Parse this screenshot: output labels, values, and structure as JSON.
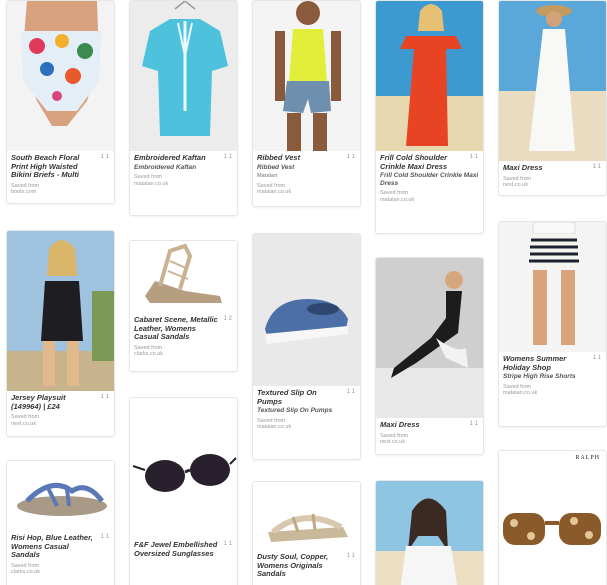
{
  "pins": [
    {
      "id": "p1",
      "title": "South Beach Floral Print High Waisted Bikini Briefs - Multi",
      "desc": "",
      "saved_label": "Saved from",
      "source": "boots.com",
      "count": "1 1",
      "icon": "floral-bikini-briefs-image"
    },
    {
      "id": "p2",
      "title": "Embroidered Kaftan",
      "desc": "Embroidered Kaftan",
      "saved_label": "Saved from",
      "source": "matalan.co.uk",
      "count": "1 1",
      "icon": "kaftan-image"
    },
    {
      "id": "p3",
      "title": "Ribbed Vest",
      "desc": "Ribbed Vest",
      "saved_label": "Saved from",
      "source": "matalan.co.uk",
      "count": "1 1",
      "icon": "ribbed-vest-image",
      "brand": "Matalan"
    },
    {
      "id": "p4",
      "title": "Frill Cold Shoulder Crinkle Maxi Dress",
      "desc": "Frill Cold Shoulder Crinkle Maxi Dress",
      "saved_label": "Saved from",
      "source": "matalan.co.uk",
      "count": "1 1",
      "icon": "red-maxi-dress-image"
    },
    {
      "id": "p5",
      "title": "Maxi Dress",
      "desc": "",
      "saved_label": "Saved from",
      "source": "next.co.uk",
      "count": "1 1",
      "icon": "white-maxi-dress-image"
    },
    {
      "id": "p6",
      "title": "Jersey Playsuit (149964) | £24",
      "desc": "",
      "saved_label": "Saved from",
      "source": "next.co.uk",
      "count": "1 1",
      "icon": "playsuit-image"
    },
    {
      "id": "p7",
      "title": "Cabaret Scene, Metallic Leather, Womens Casual Sandals",
      "desc": "",
      "saved_label": "Saved from",
      "source": "clarks.co.uk",
      "count": "1 2",
      "icon": "lace-up-sandal-image"
    },
    {
      "id": "p8",
      "title": "Textured Slip On Pumps",
      "desc": "Textured Slip On Pumps",
      "saved_label": "Saved from",
      "source": "matalan.co.uk",
      "count": "1 1",
      "icon": "slip-on-pump-image"
    },
    {
      "id": "p9",
      "title": "Maxi Dress",
      "desc": "",
      "saved_label": "Saved from",
      "source": "next.co.uk",
      "count": "1 1",
      "icon": "black-maxi-dress-image"
    },
    {
      "id": "p10",
      "title": "Womens Summer Holiday Shop",
      "desc": "Stripe High Rise Shorts",
      "saved_label": "Saved from",
      "source": "matalan.co.uk",
      "count": "1 1",
      "icon": "striped-shorts-image"
    },
    {
      "id": "p11",
      "title": "Risi Hop, Blue Leather, Womens Casual Sandals",
      "desc": "",
      "saved_label": "Saved from",
      "source": "clarks.co.uk",
      "count": "1 1",
      "icon": "blue-sandal-image"
    },
    {
      "id": "p12",
      "title": "F&F Jewel Embellished Oversized Sunglasses",
      "desc": "",
      "saved_label": "",
      "source": "",
      "count": "1 1",
      "icon": "black-sunglasses-image"
    },
    {
      "id": "p13",
      "title": "Dusty Soul, Copper, Womens Originals Sandals",
      "desc": "",
      "saved_label": "",
      "source": "",
      "count": "1 1",
      "icon": "copper-sandal-image"
    },
    {
      "id": "p14",
      "title": "",
      "desc": "",
      "saved_label": "",
      "source": "",
      "count": "",
      "icon": "white-top-model-image"
    },
    {
      "id": "p15",
      "title": "",
      "desc": "",
      "saved_label": "",
      "source": "",
      "count": "",
      "icon": "tortoiseshell-sunglasses-image",
      "brand": "RALPH"
    }
  ]
}
